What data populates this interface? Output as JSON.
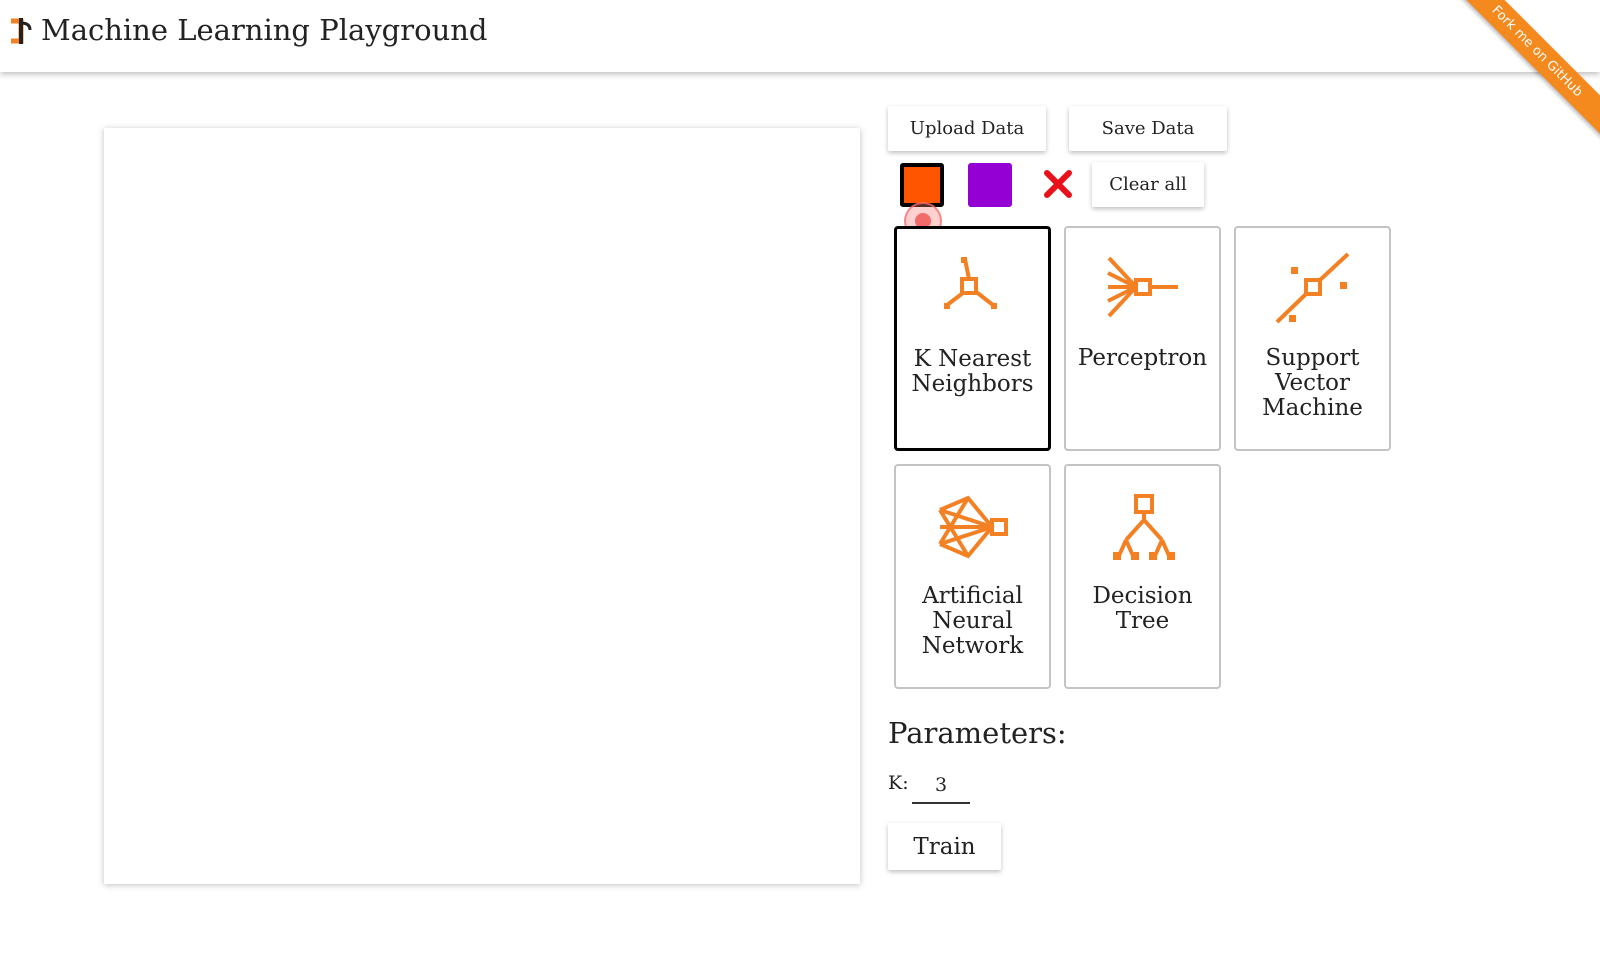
{
  "header": {
    "title": "Machine Learning Playground",
    "ribbon_text": "Fork me on GitHub",
    "ribbon_color": "#f48a1e"
  },
  "toolbar": {
    "upload_label": "Upload Data",
    "save_label": "Save Data",
    "clear_label": "Clear all"
  },
  "palette": {
    "colors": [
      "#ff5500",
      "#9400d3"
    ],
    "selected_index": 0,
    "eraser_icon": "close-icon"
  },
  "algorithms": [
    {
      "label": "K Nearest Neighbors",
      "icon": "knn-icon",
      "selected": true
    },
    {
      "label": "Perceptron",
      "icon": "perceptron-icon",
      "selected": false
    },
    {
      "label": "Support Vector Machine",
      "icon": "svm-icon",
      "selected": false
    },
    {
      "label": "Artificial Neural Network",
      "icon": "neural-network-icon",
      "selected": false
    },
    {
      "label": "Decision Tree",
      "icon": "decision-tree-icon",
      "selected": false
    }
  ],
  "parameters": {
    "heading": "Parameters:",
    "k_label": "K:",
    "k_value": "3",
    "train_label": "Train"
  },
  "accent_color": "#f48024"
}
